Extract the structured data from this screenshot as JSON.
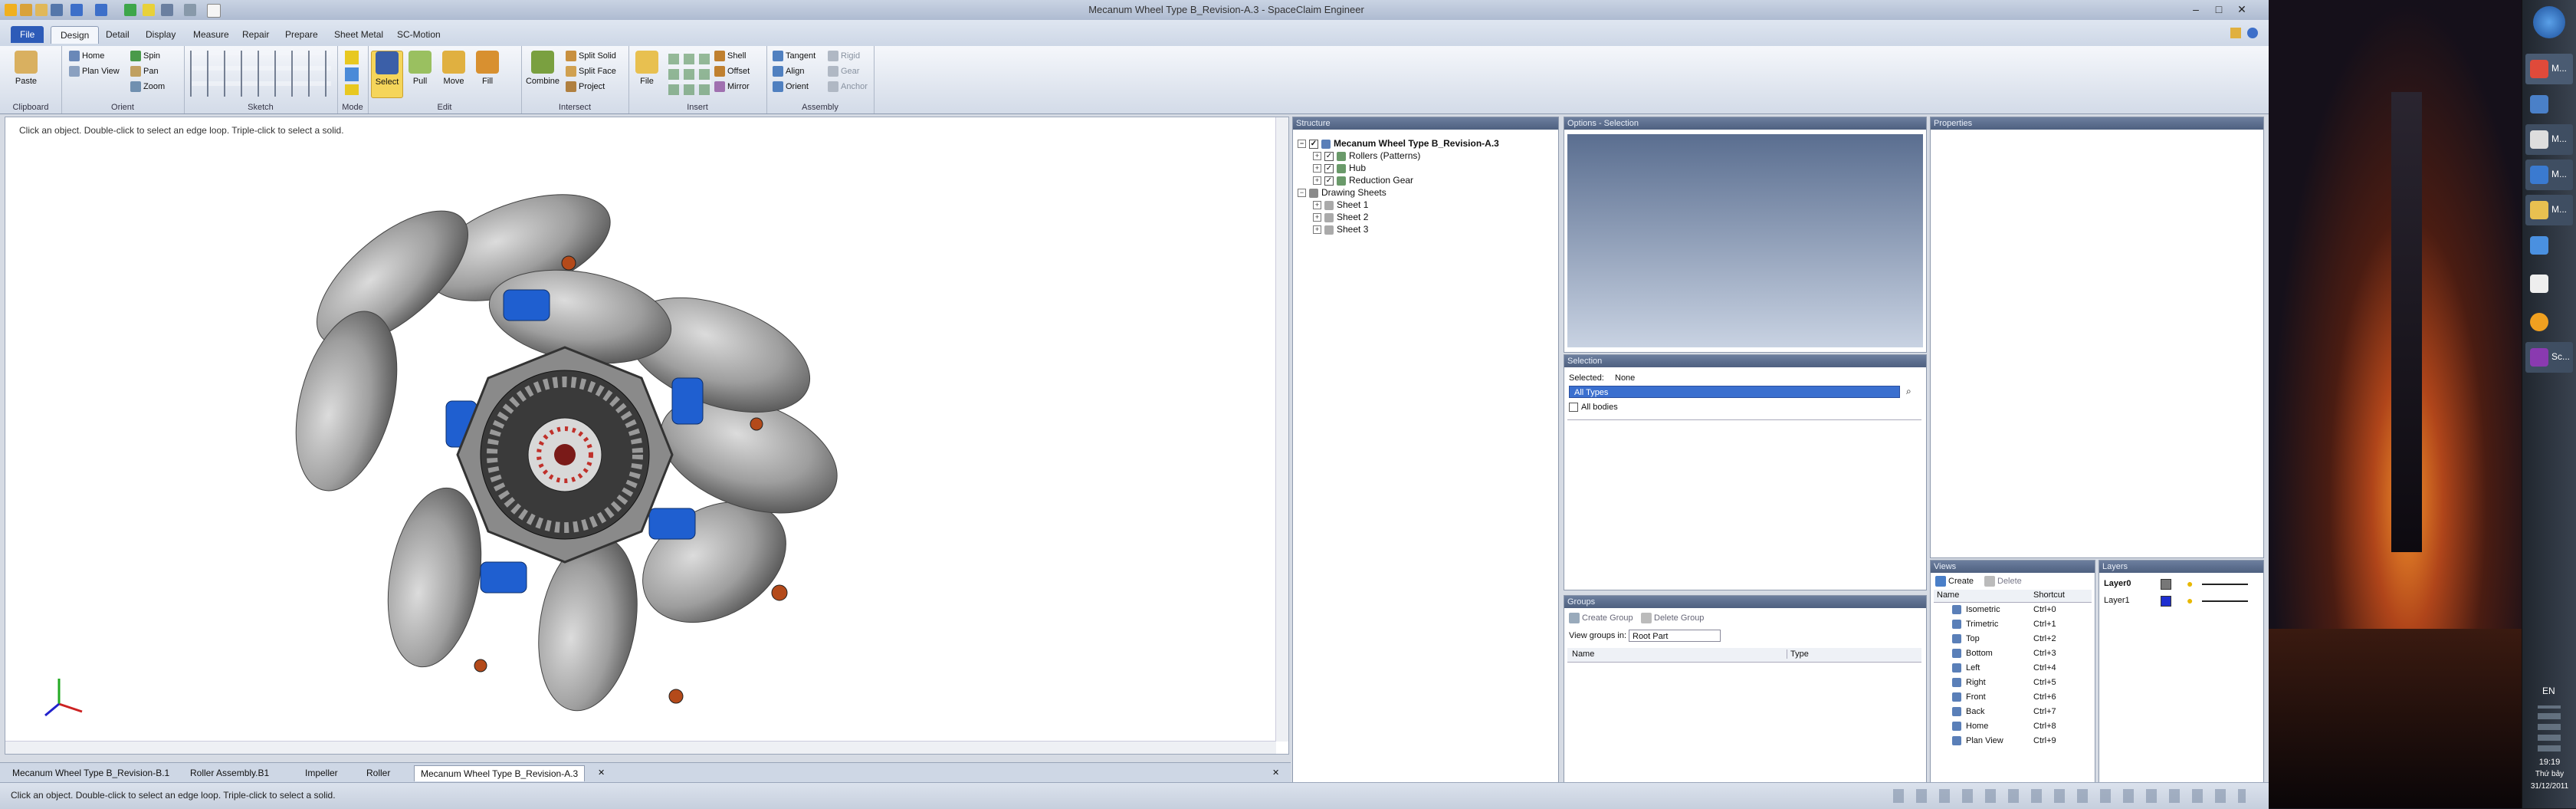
{
  "window": {
    "title": "Mecanum Wheel Type B_Revision-A.3 - SpaceClaim Engineer"
  },
  "tabs": {
    "file": "File",
    "design": "Design",
    "detail": "Detail",
    "display": "Display",
    "measure": "Measure",
    "repair": "Repair",
    "prepare": "Prepare",
    "sheet_metal": "Sheet Metal",
    "sc_motion": "SC-Motion"
  },
  "ribbon": {
    "clipboard": {
      "label": "Clipboard",
      "paste": "Paste"
    },
    "orient": {
      "label": "Orient",
      "home": "Home",
      "spin": "Spin",
      "plan_view": "Plan View",
      "pan": "Pan",
      "zoom": "Zoom"
    },
    "sketch": {
      "label": "Sketch"
    },
    "mode": {
      "label": "Mode"
    },
    "edit": {
      "label": "Edit",
      "select": "Select",
      "pull": "Pull",
      "move": "Move",
      "fill": "Fill"
    },
    "intersect": {
      "label": "Intersect",
      "combine": "Combine",
      "split_solid": "Split Solid",
      "split_face": "Split Face",
      "project": "Project"
    },
    "insert": {
      "label": "Insert",
      "file": "File",
      "shell": "Shell",
      "offset": "Offset",
      "mirror": "Mirror"
    },
    "assembly": {
      "label": "Assembly",
      "tangent": "Tangent",
      "align": "Align",
      "orient": "Orient",
      "rigid": "Rigid",
      "gear": "Gear",
      "anchor": "Anchor"
    }
  },
  "viewport": {
    "hint": "Click an object. Double-click to select an edge loop. Triple-click to select a solid."
  },
  "doc_tabs": [
    "Mecanum Wheel Type B_Revision-B.1",
    "Roller Assembly.B1",
    "Impeller",
    "Roller",
    "Mecanum Wheel Type B_Revision-A.3"
  ],
  "status": {
    "text": "Click an object. Double-click to select an edge loop. Triple-click to select a solid."
  },
  "structure": {
    "title": "Structure",
    "root": "Mecanum Wheel Type B_Revision-A.3",
    "children": [
      "Rollers (Patterns)",
      "Hub",
      "Reduction Gear"
    ],
    "drawing": "Drawing Sheets",
    "sheets": [
      "Sheet 1",
      "Sheet 2",
      "Sheet 3"
    ]
  },
  "options": {
    "title": "Options - Selection"
  },
  "properties": {
    "title": "Properties"
  },
  "selection": {
    "title": "Selection",
    "selected_label": "Selected:",
    "selected_value": "None",
    "filter": "All Types",
    "all_bodies": "All bodies"
  },
  "groups": {
    "title": "Groups",
    "create": "Create Group",
    "delete": "Delete Group",
    "view_label": "View groups in:",
    "view_value": "Root Part",
    "col_name": "Name",
    "col_type": "Type"
  },
  "views": {
    "title": "Views",
    "create": "Create",
    "delete": "Delete",
    "col_name": "Name",
    "col_shortcut": "Shortcut",
    "rows": [
      {
        "name": "Isometric",
        "key": "Ctrl+0"
      },
      {
        "name": "Trimetric",
        "key": "Ctrl+1"
      },
      {
        "name": "Top",
        "key": "Ctrl+2"
      },
      {
        "name": "Bottom",
        "key": "Ctrl+3"
      },
      {
        "name": "Left",
        "key": "Ctrl+4"
      },
      {
        "name": "Right",
        "key": "Ctrl+5"
      },
      {
        "name": "Front",
        "key": "Ctrl+6"
      },
      {
        "name": "Back",
        "key": "Ctrl+7"
      },
      {
        "name": "Home",
        "key": "Ctrl+8"
      },
      {
        "name": "Plan View",
        "key": "Ctrl+9"
      }
    ]
  },
  "layers": {
    "title": "Layers",
    "items": [
      "Layer0",
      "Layer1"
    ]
  },
  "taskbar": {
    "labels": [
      "M...",
      "M...",
      "M...",
      "M...",
      "Sc..."
    ],
    "lang": "EN",
    "time": "19:19",
    "day": "Thứ bảy",
    "date": "31/12/2011"
  },
  "colors": {
    "accent": "#2d5bb8",
    "panel_header": "#5a6b8a",
    "roller": "#9c9c9c",
    "hub_blue": "#1f5fd0"
  }
}
